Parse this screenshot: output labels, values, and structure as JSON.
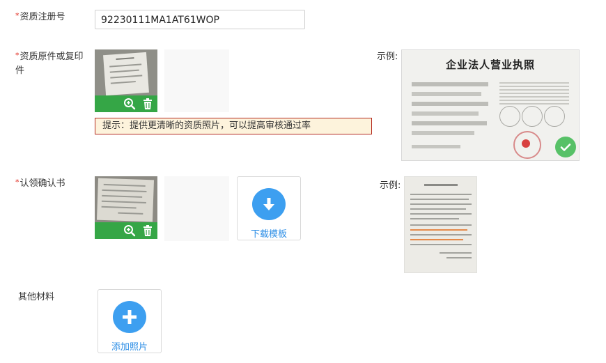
{
  "form": {
    "reg_no": {
      "required": "*",
      "label": "资质注册号",
      "value": "92230111MA1AT61WOP"
    },
    "original": {
      "required": "*",
      "label": "资质原件或复印件",
      "hint": "提示：提供更清晰的资质照片，可以提高审核通过率"
    },
    "confirm": {
      "required": "*",
      "label": "认领确认书",
      "download_label": "下载模板"
    },
    "other": {
      "label": "其他材料",
      "add_label": "添加照片"
    },
    "example_label": "示例:",
    "license_title": "企业法人营业执照"
  },
  "colors": {
    "green_bar": "#35a646",
    "accent_blue": "#3d9ff0",
    "required_red": "#e0281d",
    "hint_border": "#b42a1f"
  },
  "icons": [
    "zoom-in-icon",
    "trash-icon",
    "download-icon",
    "plus-icon",
    "check-icon"
  ]
}
